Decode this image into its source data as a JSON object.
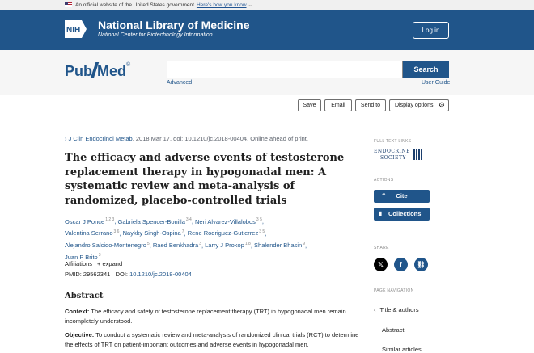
{
  "gov_banner": {
    "text": "An official website of the United States government",
    "link": "Here's how you know"
  },
  "nih": {
    "logo_text": "NIH",
    "title": "National Library of Medicine",
    "subtitle": "National Center for Biotechnology Information",
    "login_label": "Log in"
  },
  "search": {
    "logo_left": "Pub",
    "logo_right": "Med",
    "logo_reg": "®",
    "placeholder": "",
    "value": "",
    "button_label": "Search",
    "advanced_label": "Advanced",
    "user_guide_label": "User Guide"
  },
  "toolbar": {
    "save_label": "Save",
    "email_label": "Email",
    "send_to_label": "Send to",
    "display_options_label": "Display options"
  },
  "article": {
    "journal_prefix": "›",
    "journal_link": "J Clin Endocrinol Metab",
    "citation": ". 2018 Mar 17. doi: 10.1210/jc.2018-00404. Online ahead of print.",
    "title": "The efficacy and adverse events of testosterone replacement therapy in hypogonadal men: A systematic review and meta-analysis of randomized, placebo-controlled trials",
    "authors": [
      {
        "name": "Oscar J Ponce",
        "sup": "1 2 3"
      },
      {
        "name": "Gabriela Spencer-Bonilla",
        "sup": "3 4"
      },
      {
        "name": "Neri Alvarez-Villalobos",
        "sup": "3 5"
      },
      {
        "name": "Valentina Serrano",
        "sup": "3 6"
      },
      {
        "name": "Naykky Singh-Ospina",
        "sup": "7"
      },
      {
        "name": "Rene Rodriguez-Gutierrez",
        "sup": "3 5"
      },
      {
        "name": "Alejandro Salcido-Montenegro",
        "sup": "5"
      },
      {
        "name": "Raed Benkhadra",
        "sup": "3"
      },
      {
        "name": "Larry J Prokop",
        "sup": "1 8"
      },
      {
        "name": "Shalender Bhasin",
        "sup": "9"
      },
      {
        "name": "Juan P Brito",
        "sup": "3"
      }
    ],
    "affiliations_label": "Affiliations",
    "expand_label": "+ expand",
    "pmid_label": "PMID: 29562341",
    "doi_label": "DOI:",
    "doi_value": "10.1210/jc.2018-00404",
    "abstract_heading": "Abstract",
    "context_label": "Context:",
    "context_text": "The efficacy and safety of testosterone replacement therapy (TRT) in hypogonadal men remain incompletely understood.",
    "objective_label": "Objective:",
    "objective_text": "To conduct a systematic review and meta-analysis of randomized clinical trials (RCT) to determine the effects of TRT on patient-important outcomes and adverse events in hypogonadal men."
  },
  "sidebar": {
    "full_text_label": "FULL TEXT LINKS",
    "publisher_line1": "ENDOCRINE",
    "publisher_line2": "SOCIETY",
    "actions_label": "ACTIONS",
    "cite_label": "Cite",
    "collections_label": "Collections",
    "share_label": "SHARE",
    "page_nav_label": "PAGE NAVIGATION",
    "nav_items": [
      "Title & authors",
      "Abstract",
      "Similar articles"
    ]
  }
}
